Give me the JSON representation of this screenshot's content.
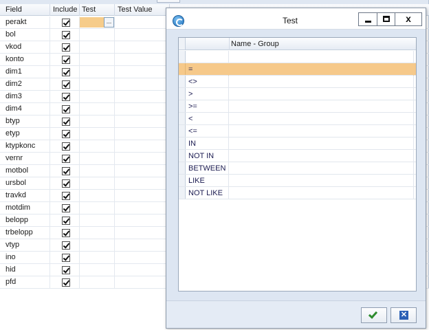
{
  "grid": {
    "columns": [
      "Field",
      "Include",
      "Test",
      "Test Value"
    ],
    "rows": [
      {
        "field": "perakt",
        "include": true
      },
      {
        "field": "bol",
        "include": true
      },
      {
        "field": "vkod",
        "include": true
      },
      {
        "field": "konto",
        "include": true
      },
      {
        "field": "dim1",
        "include": true
      },
      {
        "field": "dim2",
        "include": true
      },
      {
        "field": "dim3",
        "include": true
      },
      {
        "field": "dim4",
        "include": true
      },
      {
        "field": "btyp",
        "include": true
      },
      {
        "field": "etyp",
        "include": true
      },
      {
        "field": "ktypkonc",
        "include": true
      },
      {
        "field": "vernr",
        "include": true
      },
      {
        "field": "motbol",
        "include": true
      },
      {
        "field": "ursbol",
        "include": true
      },
      {
        "field": "travkd",
        "include": true
      },
      {
        "field": "motdim",
        "include": true
      },
      {
        "field": "belopp",
        "include": true
      },
      {
        "field": "trbelopp",
        "include": true
      },
      {
        "field": "vtyp",
        "include": true
      },
      {
        "field": "ino",
        "include": true
      },
      {
        "field": "hid",
        "include": true
      },
      {
        "field": "pfd",
        "include": true
      }
    ],
    "ellipsis_label": "..."
  },
  "dialog": {
    "title": "Test",
    "column_header": "Name - Group",
    "selected_index": 1,
    "operators": [
      "",
      "=",
      "<>",
      ">",
      ">=",
      "<",
      "<=",
      "IN",
      "NOT IN",
      "BETWEEN",
      "LIKE",
      "NOT LIKE"
    ],
    "close_label": "x",
    "cancel_label": "✕"
  },
  "colors": {
    "selection": "#f6c98a",
    "dialog_bg": "#dde6f2",
    "ok_green": "#2e8b2e",
    "cancel_blue": "#2a5fb5"
  }
}
